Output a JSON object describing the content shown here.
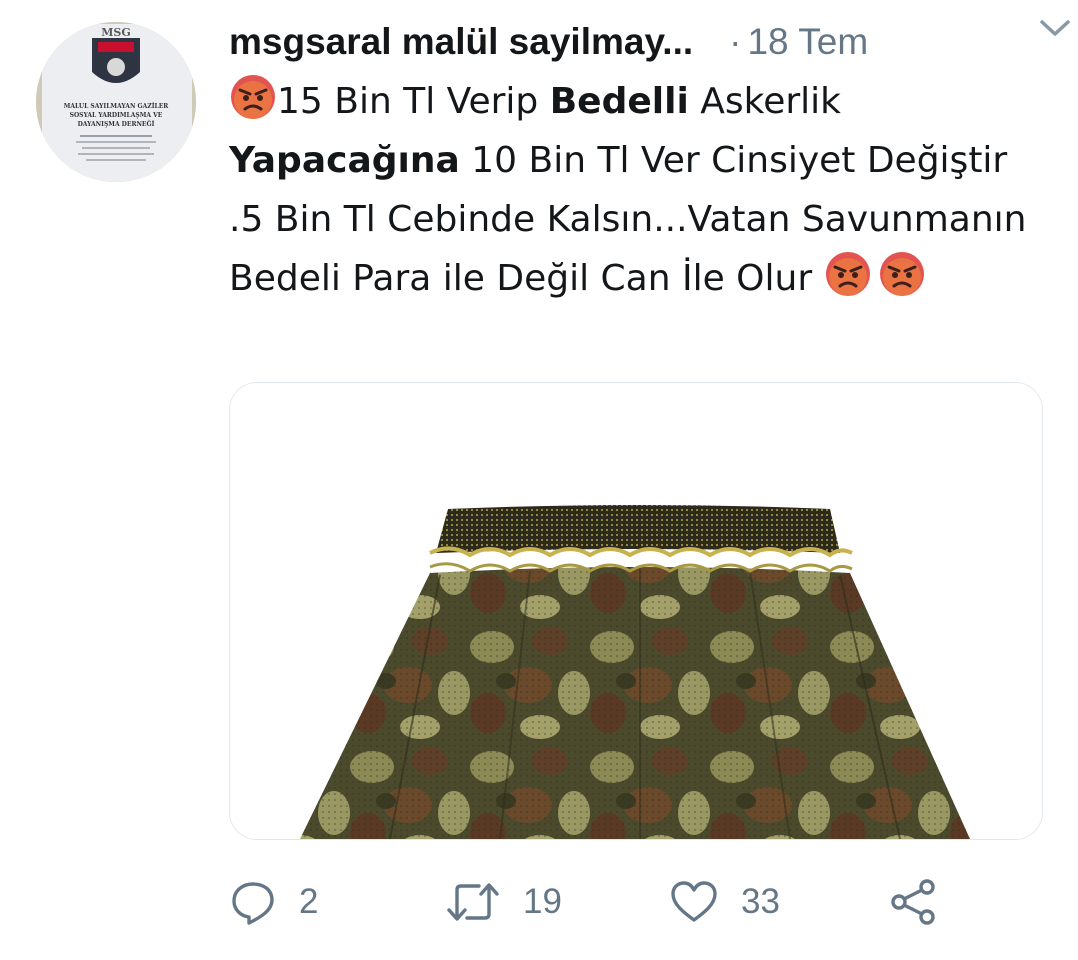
{
  "tweet": {
    "display_name": "msgsaral  malül sayilmay...",
    "separator": "·",
    "time": "18 Tem",
    "text": {
      "p1": "15 Bin Tl Verip ",
      "b1": "Bedelli",
      "p2": " Askerlik ",
      "b2": "Yapacağına",
      "p3": " 10 Bin Tl Ver Cinsiyet Değiştir .5 Bin Tl Cebinde Kalsın...Vatan Savunmanın Bedeli Para ile Değil Can İle Olur "
    },
    "emojis": [
      "angry-face-emoji",
      "angry-face-emoji",
      "angry-face-emoji"
    ]
  },
  "avatar": {
    "logo_text": "MSG",
    "org_line1": "MALUL SAYILMAYAN GAZİLER",
    "org_line2": "SOSYAL YARDIMLAŞMA VE",
    "org_line3": "DAYANIŞMA DERNEĞİ"
  },
  "actions": {
    "reply_count": "2",
    "retweet_count": "19",
    "like_count": "33"
  },
  "icons": {
    "reply": "reply-icon",
    "retweet": "retweet-icon",
    "like": "heart-icon",
    "share": "share-icon",
    "menu": "chevron-down-icon"
  },
  "colors": {
    "text": "#14171a",
    "secondary": "#657786",
    "border": "#e1e8ed"
  }
}
